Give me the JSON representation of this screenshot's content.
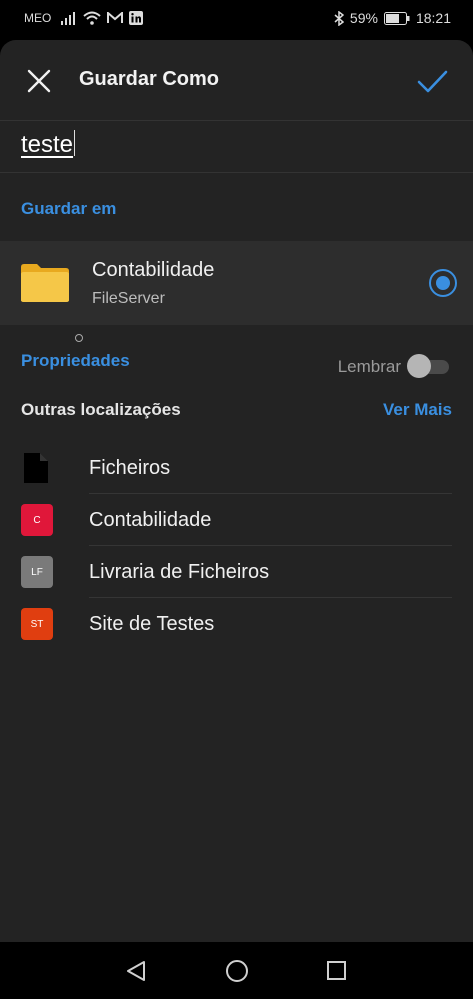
{
  "status_bar": {
    "carrier": "MEO",
    "battery": "59%",
    "time": "18:21",
    "icons": [
      "signal-icon",
      "wifi-icon",
      "gmail-icon",
      "linkedin-icon",
      "bluetooth-icon",
      "battery-icon"
    ]
  },
  "header": {
    "title": "Guardar Como",
    "close_icon": "close-icon",
    "confirm_icon": "check-icon"
  },
  "filename": {
    "value": "teste"
  },
  "save_in": {
    "label": "Guardar em",
    "location": {
      "name": "Contabilidade",
      "subtitle": "FileServer",
      "selected": true
    }
  },
  "properties": {
    "label": "Propriedades",
    "remember_label": "Lembrar",
    "remember_on": false
  },
  "other_locations": {
    "title": "Outras localizações",
    "see_more": "Ver Mais",
    "items": [
      {
        "label": "Ficheiros",
        "icon": "file-icon"
      },
      {
        "label": "Contabilidade",
        "badge": "C",
        "color": "#e0173a"
      },
      {
        "label": "Livraria de Ficheiros",
        "badge": "LF",
        "color": "#7a7a7a"
      },
      {
        "label": "Site de Testes",
        "badge": "ST",
        "color": "#e03e10"
      }
    ]
  },
  "colors": {
    "accent": "#3a8fe0",
    "background": "#232323",
    "folder": "#f5c748"
  },
  "nav_bar": {
    "icons": [
      "back-icon",
      "home-icon",
      "recents-icon"
    ]
  }
}
